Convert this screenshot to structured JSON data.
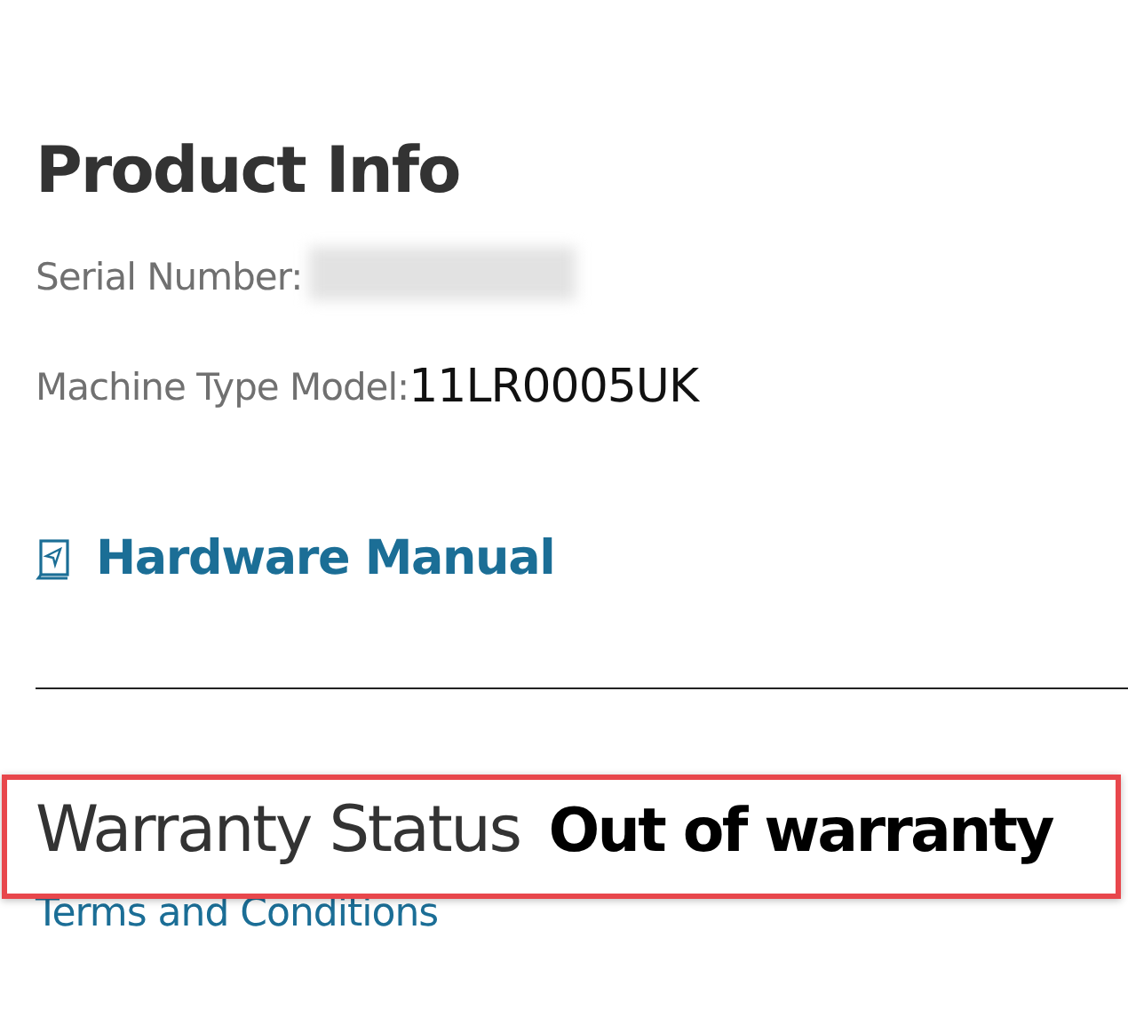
{
  "product_info": {
    "title": "Product Info",
    "serial_number": {
      "label": "Serial Number:",
      "redacted": true
    },
    "machine_type_model": {
      "label": "Machine Type Model:",
      "value": "11LR0005UK"
    },
    "hardware_manual": {
      "label": "Hardware Manual"
    }
  },
  "warranty": {
    "label": "Warranty Status",
    "status": "Out of warranty",
    "highlighted": true,
    "terms_link": "Terms and Conditions"
  }
}
